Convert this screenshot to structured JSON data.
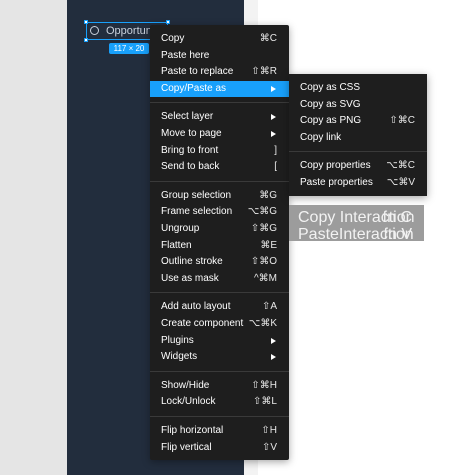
{
  "layer": {
    "name": "Opportuni",
    "size": "117 × 20"
  },
  "main_menu": {
    "groups": [
      [
        {
          "label": "Copy",
          "shortcut": "⌘C"
        },
        {
          "label": "Paste here",
          "shortcut": ""
        },
        {
          "label": "Paste to replace",
          "shortcut": "⇧⌘R"
        },
        {
          "label": "Copy/Paste as",
          "shortcut": "",
          "submenu": true,
          "active": true
        }
      ],
      [
        {
          "label": "Select layer",
          "shortcut": "",
          "submenu": true
        },
        {
          "label": "Move to page",
          "shortcut": "",
          "submenu": true
        },
        {
          "label": "Bring to front",
          "shortcut": "]"
        },
        {
          "label": "Send to back",
          "shortcut": "["
        }
      ],
      [
        {
          "label": "Group selection",
          "shortcut": "⌘G"
        },
        {
          "label": "Frame selection",
          "shortcut": "⌥⌘G"
        },
        {
          "label": "Ungroup",
          "shortcut": "⇧⌘G"
        },
        {
          "label": "Flatten",
          "shortcut": "⌘E"
        },
        {
          "label": "Outline stroke",
          "shortcut": "⇧⌘O"
        },
        {
          "label": "Use as mask",
          "shortcut": "^⌘M"
        }
      ],
      [
        {
          "label": "Add auto layout",
          "shortcut": "⇧A"
        },
        {
          "label": "Create component",
          "shortcut": "⌥⌘K"
        },
        {
          "label": "Plugins",
          "shortcut": "",
          "submenu": true
        },
        {
          "label": "Widgets",
          "shortcut": "",
          "submenu": true
        }
      ],
      [
        {
          "label": "Show/Hide",
          "shortcut": "⇧⌘H"
        },
        {
          "label": "Lock/Unlock",
          "shortcut": "⇧⌘L"
        }
      ],
      [
        {
          "label": "Flip horizontal",
          "shortcut": "⇧H"
        },
        {
          "label": "Flip vertical",
          "shortcut": "⇧V"
        }
      ]
    ]
  },
  "sub_menu": {
    "groups": [
      [
        {
          "label": "Copy as CSS",
          "shortcut": ""
        },
        {
          "label": "Copy as SVG",
          "shortcut": ""
        },
        {
          "label": "Copy as PNG",
          "shortcut": "⇧⌘C"
        },
        {
          "label": "Copy link",
          "shortcut": ""
        }
      ],
      [
        {
          "label": "Copy properties",
          "shortcut": "⌥⌘C"
        },
        {
          "label": "Paste properties",
          "shortcut": "⌥⌘V"
        }
      ]
    ]
  },
  "interaction_menu": {
    "items": [
      {
        "label": "Copy Interaction",
        "shortcut": "fn C"
      },
      {
        "label": "PasteInteraction",
        "shortcut": "fn V"
      }
    ]
  },
  "colors": {
    "accent": "#18a0fb",
    "menu_bg": "#1e1e1e",
    "frame_bg": "#222d3d"
  }
}
